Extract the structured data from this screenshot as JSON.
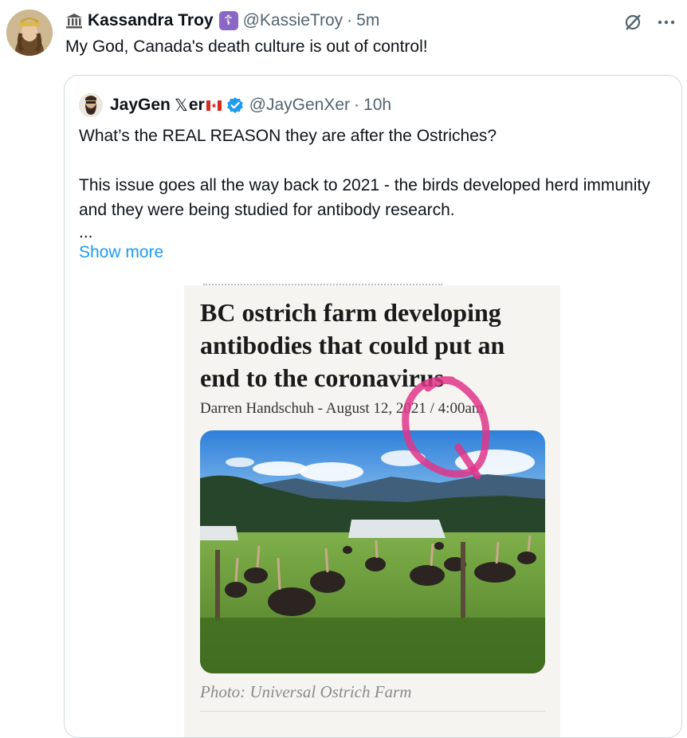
{
  "tweet": {
    "author_name": "Kassandra Troy",
    "author_handle": "@KassieTroy",
    "separator": "·",
    "time": "5m",
    "text": "My God, Canada's death culture is out of control!",
    "icons": [
      "museum-icon",
      "orthodox-cross-badge-icon",
      "grok-icon",
      "more-icon"
    ]
  },
  "quote": {
    "author_name_part1": "JayGen",
    "author_name_x": "𝕏",
    "author_name_part2": "er",
    "author_handle": "@JayGenXer",
    "separator": "·",
    "time": "10h",
    "line1": "What’s the REAL REASON they are after the Ostriches?",
    "line2": "This issue goes all the way back to 2021 - the birds developed herd immunity and they were being studied for antibody research.",
    "ellipsis": "...",
    "show_more": "Show more",
    "icons": [
      "canada-flag-icon",
      "verified-badge-icon"
    ]
  },
  "article": {
    "headline": "BC ostrich farm developing antibodies that could put an end to the coronavirus",
    "byline": "Darren Handschuh - August 12, 2021 / 4:00am",
    "caption": "Photo: Universal Ostrich Farm"
  },
  "colors": {
    "link": "#1d9bf0",
    "muted": "#536471",
    "badge_purple": "#8a67c4",
    "verified_blue": "#1d9bf0",
    "annotation_pink": "#e0358a"
  }
}
